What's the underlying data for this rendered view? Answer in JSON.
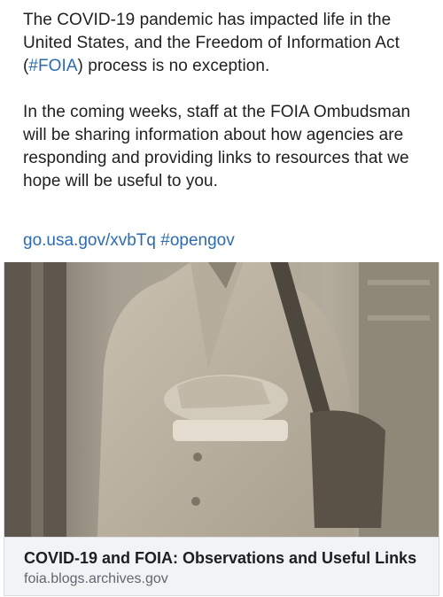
{
  "post": {
    "paragraph1": {
      "before": "The COVID-19 pandemic has impacted life in the United States, and the Freedom of Information Act (",
      "hashtag": "#FOIA",
      "after": ") process is no exception."
    },
    "paragraph2": "In the coming weeks, staff at the FOIA Ombudsman will be sharing information about how agencies are responding and providing links to resources that we hope will be useful to you.",
    "short_link": "go.usa.gov/xvbTq",
    "hashtag2": "#opengov"
  },
  "card": {
    "image_icon": "sepia-archival-photo",
    "title": "COVID-19 and FOIA: Observations and Useful Links",
    "domain": "foia.blogs.archives.gov"
  },
  "colors": {
    "link": "#2b6cb0",
    "text": "#1f1f1f",
    "card_footer_bg": "#f2f3f5",
    "domain_text": "#606770"
  }
}
